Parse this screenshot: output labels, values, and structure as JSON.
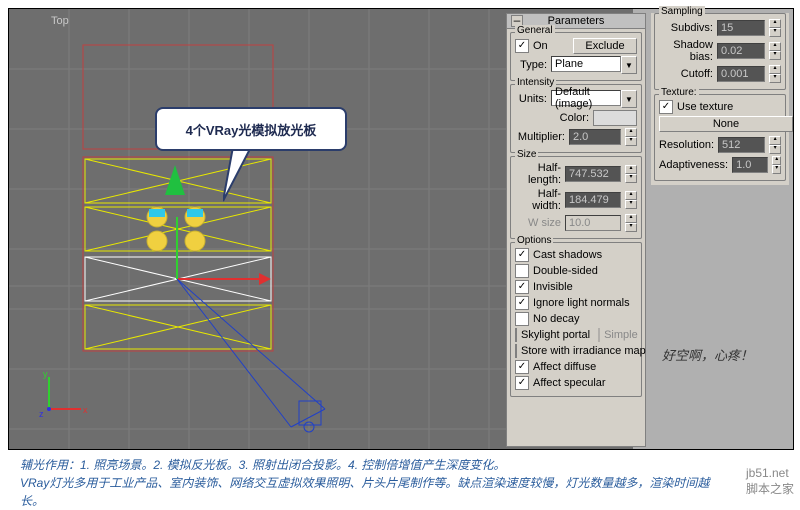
{
  "viewport": {
    "label": "Top"
  },
  "callout": {
    "text": "4个VRay光模拟放光板"
  },
  "parameters_panel": {
    "title": "Parameters",
    "general": {
      "title": "General",
      "on": "On",
      "exclude": "Exclude",
      "type_label": "Type:",
      "type_value": "Plane"
    },
    "intensity": {
      "title": "Intensity",
      "units_label": "Units:",
      "units_value": "Default (image)",
      "color_label": "Color:",
      "multiplier_label": "Multiplier:",
      "multiplier_value": "2.0"
    },
    "size": {
      "title": "Size",
      "half_length_label": "Half-length:",
      "half_length_value": "747.532",
      "half_width_label": "Half-width:",
      "half_width_value": "184.479",
      "w_size_label": "W size",
      "w_size_value": "10.0"
    },
    "options": {
      "title": "Options",
      "cast_shadows": "Cast shadows",
      "double_sided": "Double-sided",
      "invisible": "Invisible",
      "ignore_light_normals": "Ignore light normals",
      "no_decay": "No decay",
      "skylight_portal": "Skylight portal",
      "simple": "Simple",
      "store_irradiance": "Store with irradiance map",
      "affect_diffuse": "Affect diffuse",
      "affect_specular": "Affect specular"
    }
  },
  "sampling_panel": {
    "title": "Sampling",
    "subdivs_label": "Subdivs:",
    "subdivs_value": "15",
    "shadow_bias_label": "Shadow bias:",
    "shadow_bias_value": "0.02",
    "cutoff_label": "Cutoff:",
    "cutoff_value": "0.001"
  },
  "texture_panel": {
    "title": "Texture:",
    "use_texture": "Use texture",
    "none_btn": "None",
    "resolution_label": "Resolution:",
    "resolution_value": "512",
    "adaptiveness_label": "Adaptiveness:",
    "adaptiveness_value": "1.0"
  },
  "side_note": "好空啊，心疼！",
  "bottom_text": {
    "line1": "辅光作用：1. 照亮场景。2. 模拟反光板。3. 照射出闭合投影。4. 控制倍增值产生深度变化。",
    "line2": "VRay灯光多用于工业产品、室内装饰、网络交互虚拟效果照明、片头片尾制作等。缺点渲染速度较慢，灯光数量越多，渲染时间越长。"
  },
  "watermark_site": "jb51.net",
  "watermark_sub": "脚本之家"
}
